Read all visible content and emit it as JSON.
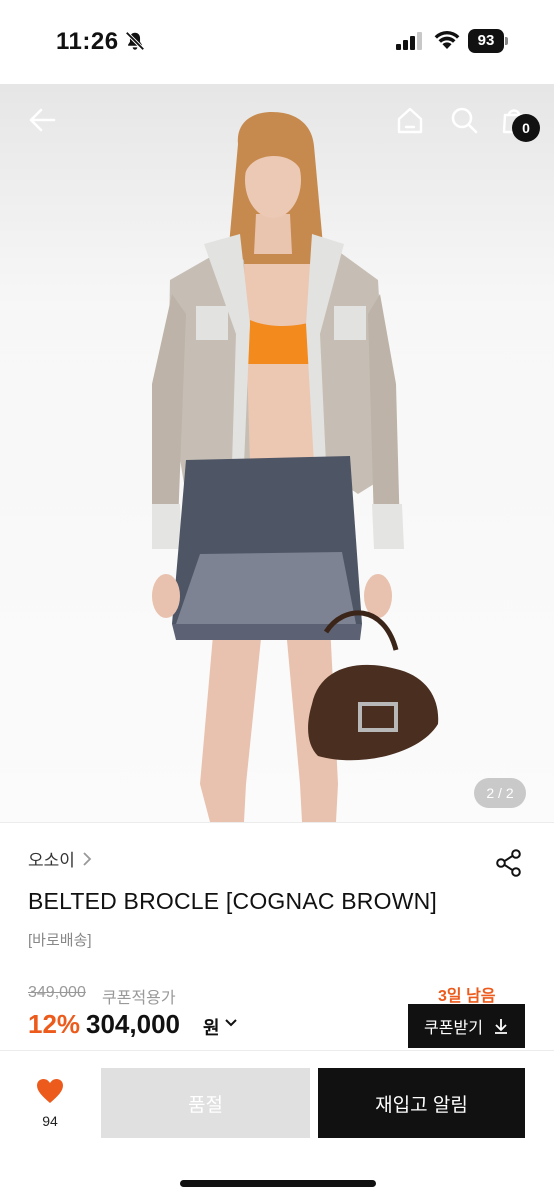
{
  "status_bar": {
    "time": "11:26",
    "battery": "93"
  },
  "nav": {
    "cart_count": "0"
  },
  "gallery": {
    "page_indicator": "2 / 2"
  },
  "product": {
    "brand": "오소이",
    "name": "BELTED BROCLE [COGNAC BROWN]",
    "shipping_tag": "[바로배송]"
  },
  "price": {
    "original": "349,000",
    "coupon_label": "쿠폰적용가",
    "days_left": "3일 남음",
    "discount": "12%",
    "sale": "304,000",
    "currency": "원",
    "coupon_button": "쿠폰받기"
  },
  "bottom_bar": {
    "like_count": "94",
    "soldout_label": "품절",
    "restock_label": "재입고 알림"
  },
  "colors": {
    "accent": "#ec5b1c",
    "black": "#111111",
    "disabled": "#e0e0e0"
  },
  "icons": [
    "bell-off-icon",
    "signal-icon",
    "wifi-icon",
    "battery-icon",
    "back-arrow-icon",
    "home-icon",
    "search-icon",
    "bag-icon",
    "share-icon",
    "chevron-down-icon",
    "download-icon",
    "heart-icon"
  ]
}
